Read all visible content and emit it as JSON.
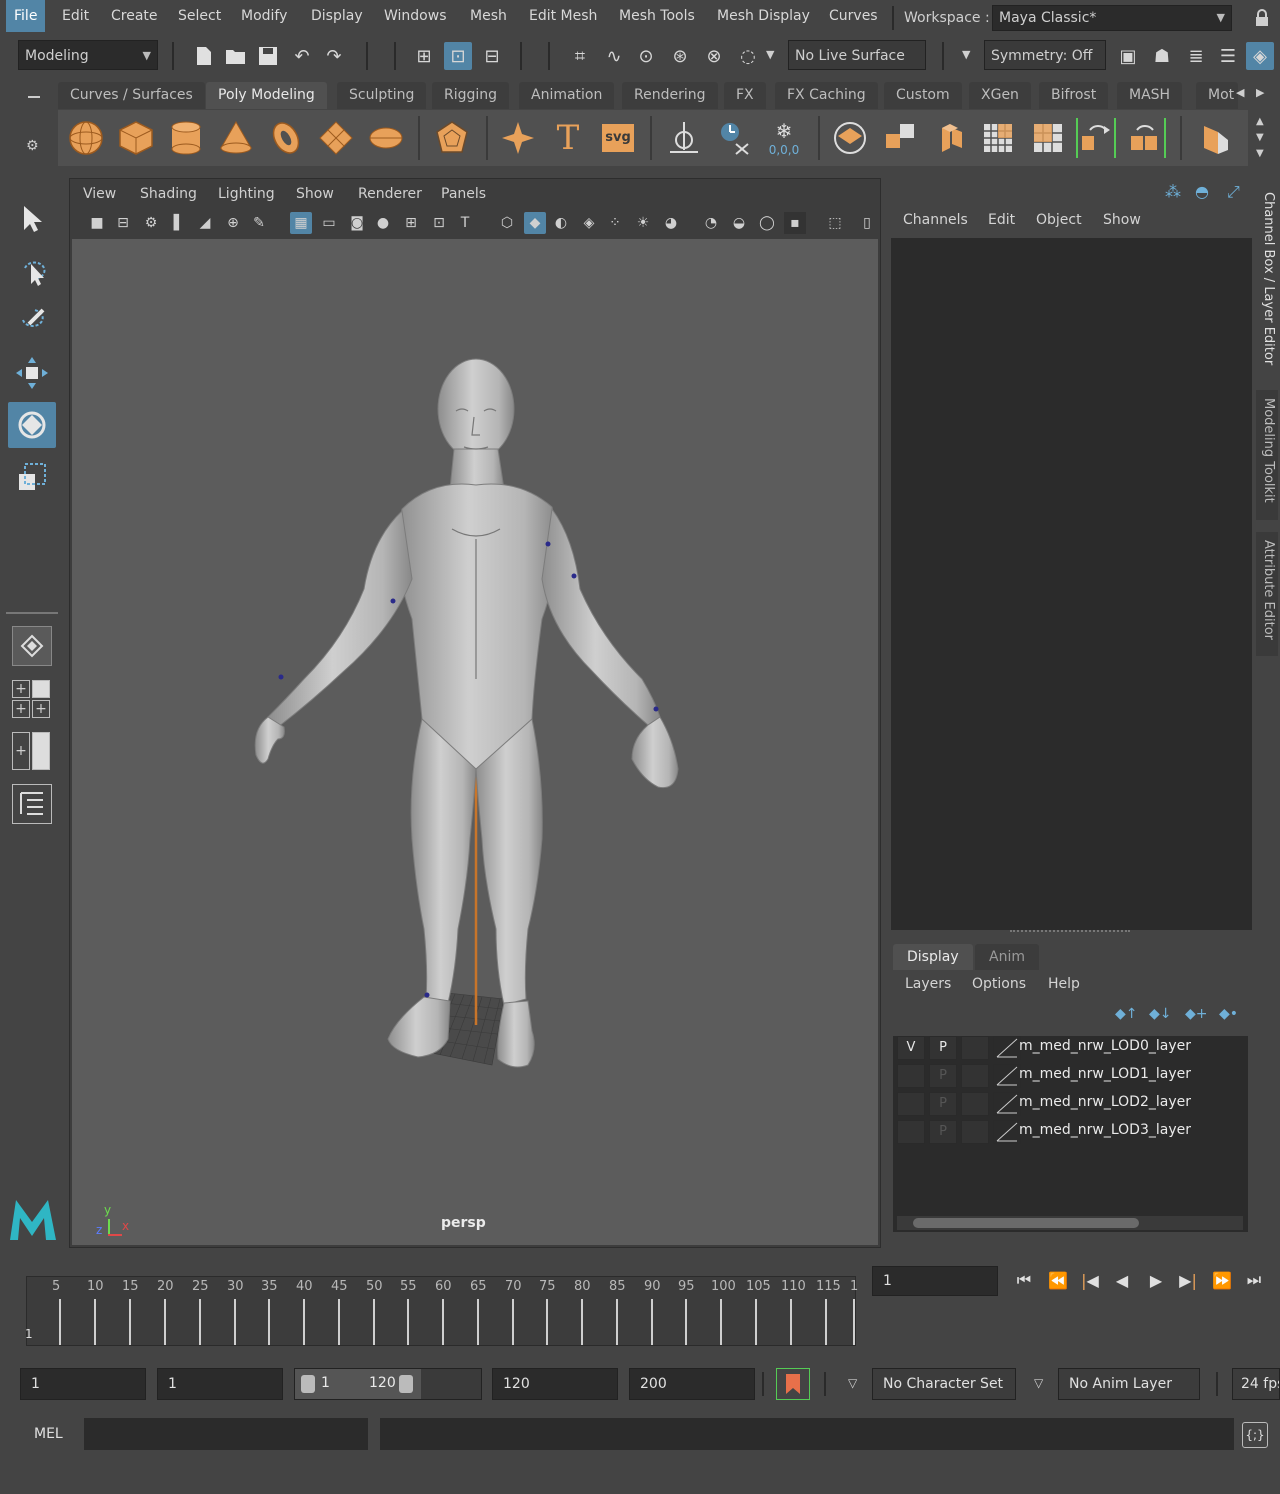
{
  "menubar": {
    "items": [
      "File",
      "Edit",
      "Create",
      "Select",
      "Modify",
      "Display",
      "Windows",
      "Mesh",
      "Edit Mesh",
      "Mesh Tools",
      "Mesh Display",
      "Curves"
    ],
    "workspace_label": "Workspace :",
    "workspace_value": "Maya Classic*"
  },
  "statusline": {
    "mode": "Modeling",
    "live_surface": "No Live Surface",
    "symmetry": "Symmetry: Off"
  },
  "shelf": {
    "tabs": [
      "Curves / Surfaces",
      "Poly Modeling",
      "Sculpting",
      "Rigging",
      "Animation",
      "Rendering",
      "FX",
      "FX Caching",
      "Custom",
      "XGen",
      "Bifrost",
      "MASH",
      "Mot"
    ],
    "active_tab": "Poly Modeling",
    "svg_label": "svg",
    "text_label": "T",
    "coord_label": "0,0,0"
  },
  "viewport": {
    "menus": [
      "View",
      "Shading",
      "Lighting",
      "Show",
      "Renderer",
      "Panels"
    ],
    "camera": "persp",
    "axis_y": "y",
    "axis_x": "x",
    "axis_z": "z"
  },
  "channelbox": {
    "menus": [
      "Channels",
      "Edit",
      "Object",
      "Show"
    ]
  },
  "layereditor": {
    "tabs": [
      "Display",
      "Anim"
    ],
    "menus": [
      "Layers",
      "Options",
      "Help"
    ],
    "layers": [
      {
        "v": "V",
        "p": "P",
        "name": "m_med_nrw_LOD0_layer"
      },
      {
        "v": "",
        "p": "P",
        "name": "m_med_nrw_LOD1_layer"
      },
      {
        "v": "",
        "p": "P",
        "name": "m_med_nrw_LOD2_layer"
      },
      {
        "v": "",
        "p": "P",
        "name": "m_med_nrw_LOD3_layer"
      }
    ]
  },
  "sidetabs": [
    "Channel Box / Layer Editor",
    "Modeling Toolkit",
    "Attribute Editor"
  ],
  "timeline": {
    "ticks": [
      "5",
      "10",
      "15",
      "20",
      "25",
      "30",
      "35",
      "40",
      "45",
      "50",
      "55",
      "60",
      "65",
      "70",
      "75",
      "80",
      "85",
      "90",
      "95",
      "100",
      "105",
      "110",
      "115",
      "1"
    ],
    "start_marker": "1",
    "current_frame": "1"
  },
  "range": {
    "start": "1",
    "playback_start": "1",
    "range_min": "1",
    "range_max": "120",
    "playback_end": "120",
    "end": "200",
    "character_set": "No Character Set",
    "anim_layer": "No Anim Layer",
    "fps": "24 fps"
  },
  "cmdline": {
    "language": "MEL"
  },
  "colors": {
    "accent": "#5285a6",
    "shelf_orange": "#e8a15a",
    "viewport_bg": "#5c5c5c"
  }
}
